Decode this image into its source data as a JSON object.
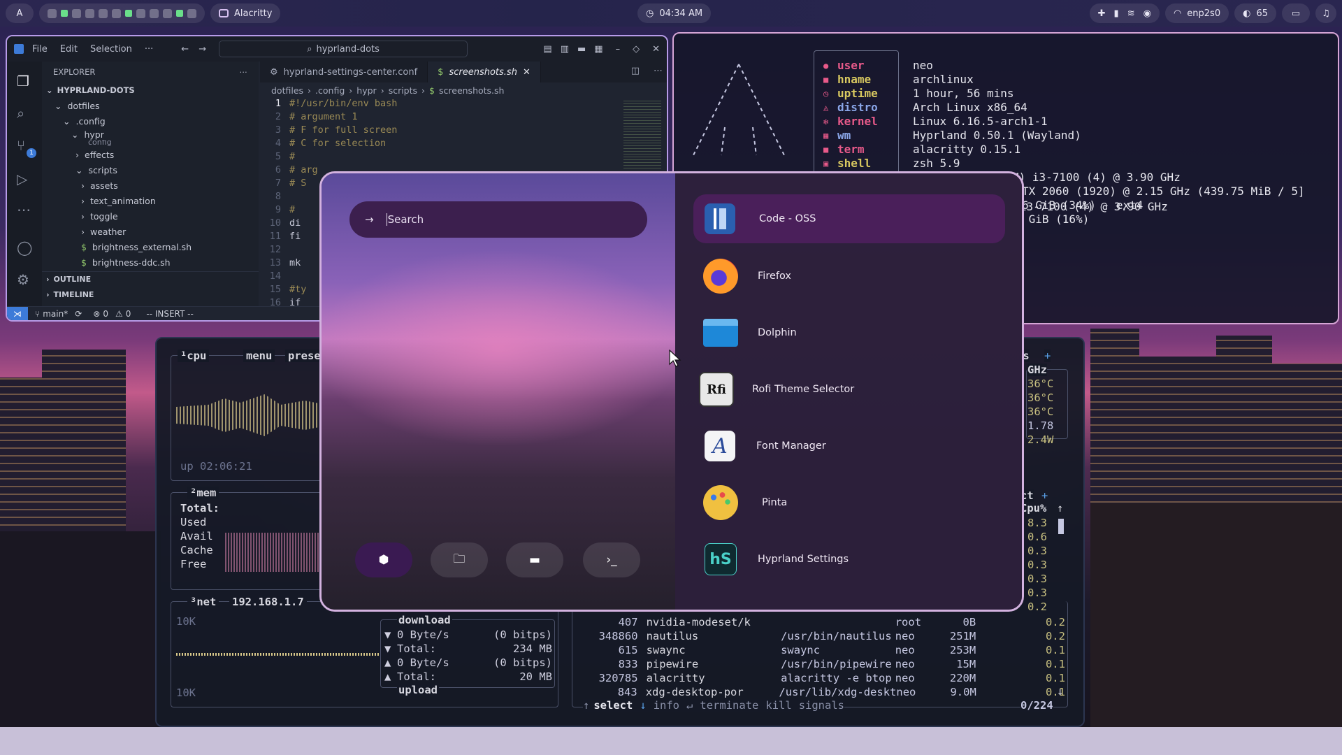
{
  "topbar": {
    "window_title": "Alacritty",
    "clock": "04:34 AM",
    "network": "enp2s0",
    "volume": "65"
  },
  "vscode": {
    "menu": [
      "File",
      "Edit",
      "Selection",
      "···"
    ],
    "search": "hyprland-dots",
    "explorer_title": "EXPLORER",
    "root": "HYPRLAND-DOTS",
    "tree": [
      "dotfiles",
      ".config",
      "hypr",
      "config",
      "effects",
      "scripts",
      "assets",
      "text_animation",
      "toggle",
      "weather",
      "brightness_external.sh",
      "brightness-ddc.sh"
    ],
    "outline": "OUTLINE",
    "timeline": "TIMELINE",
    "tabs": [
      "hyprland-settings-center.conf",
      "screenshots.sh"
    ],
    "breadcrumb": [
      "dotfiles",
      ".config",
      "hypr",
      "scripts",
      "screenshots.sh"
    ],
    "lines": [
      "#!/usr/bin/env bash",
      "# argument 1",
      "# F for full screen",
      "# C for selection",
      "#",
      "# arg",
      "# S",
      "",
      "# ",
      "di",
      "fi",
      "",
      "mk",
      "",
      "#ty",
      "if"
    ],
    "status": {
      "branch": "main*",
      "problems": "0",
      "warnings": "0",
      "mode": "-- INSERT --"
    },
    "scm_badge": "1"
  },
  "fastfetch": {
    "rows": [
      {
        "key": "user",
        "value": "neo"
      },
      {
        "key": "hname",
        "value": "archlinux"
      },
      {
        "key": "uptime",
        "value": "1 hour, 56 mins"
      },
      {
        "key": "distro",
        "value": "Arch Linux x86_64"
      },
      {
        "key": "kernel",
        "value": "Linux 6.16.5-arch1-1"
      },
      {
        "key": "wm",
        "value": "Hyprland 0.50.1 (Wayland)"
      },
      {
        "key": "term",
        "value": "alacritty 0.15.1"
      },
      {
        "key": "shell",
        "value": "zsh 5.9"
      }
    ],
    "extra": [
      "M) i3-7100 (4) @ 3.90 GHz",
      "TX 2060 (1920) @ 2.15 GHz (439.75 MiB / 5]",
      "6 GiB (34%) - ext4",
      " GiB (16%)"
    ]
  },
  "btop": {
    "cpu_title": "¹cpu",
    "menu": "menu",
    "preset": "prese",
    "uptime": "up 02:06:21",
    "mem_title": "²mem",
    "mem_labels": [
      "Total:",
      "Used",
      "Avail",
      "Cache",
      "Free"
    ],
    "net_title": "³net",
    "ip": "192.168.1.7",
    "net_scale_top": "10K",
    "net_scale_bottom": "10K",
    "download": "download",
    "upload": "upload",
    "net_rows": [
      {
        "sym": "▼",
        "label": "0 Byte/s",
        "val": "(0 bitps)"
      },
      {
        "sym": "▼",
        "label": "Total:",
        "val": "234 MB"
      },
      {
        "sym": "▲",
        "label": "0 Byte/s",
        "val": "(0 bitps)"
      },
      {
        "sym": "▲",
        "label": "Total:",
        "val": "20 MB"
      }
    ],
    "proc_rows": [
      {
        "pid": "407",
        "name": "nvidia-modeset/k",
        "path": "",
        "user": "root",
        "mem": "0B",
        "cpu": "0.2"
      },
      {
        "pid": "348860",
        "name": "nautilus",
        "path": "/usr/bin/nautilus",
        "user": "neo",
        "mem": "251M",
        "cpu": "0.2"
      },
      {
        "pid": "615",
        "name": "swaync",
        "path": "swaync",
        "user": "neo",
        "mem": "253M",
        "cpu": "0.1"
      },
      {
        "pid": "833",
        "name": "pipewire",
        "path": "/usr/bin/pipewire",
        "user": "neo",
        "mem": "15M",
        "cpu": "0.1"
      },
      {
        "pid": "320785",
        "name": "alacritty",
        "path": "alacritty -e btop",
        "user": "neo",
        "mem": "220M",
        "cpu": "0.1"
      },
      {
        "pid": "843",
        "name": "xdg-desktop-por",
        "path": "/usr/lib/xdg-deskt",
        "user": "neo",
        "mem": "9.0M",
        "cpu": "0.1"
      }
    ],
    "footer": {
      "select": "select",
      "info": "info",
      "terminate": "terminate",
      "kill": "kill",
      "signals": "signals",
      "count": "0/224"
    },
    "right_col": {
      "hdr": "ns",
      "ghz": "GHz",
      "temps": [
        "36°C",
        "36°C",
        "36°C"
      ],
      "load": "1.78",
      "watt": "2.4W",
      "cpu_hdr": "Cpu%",
      "ct": "ct",
      "cpus": [
        "8.3",
        "0.6",
        "0.3",
        "0.3",
        "0.3",
        "0.3",
        "0.2"
      ]
    }
  },
  "rofi": {
    "search_placeholder": "Search",
    "apps": [
      "Code - OSS",
      "Firefox",
      "Dolphin",
      "Rofi Theme Selector",
      "Font Manager",
      "Pinta",
      "Hyprland Settings"
    ],
    "modes": [
      "apps-icon",
      "folder-icon",
      "window-icon",
      "terminal-icon"
    ]
  }
}
